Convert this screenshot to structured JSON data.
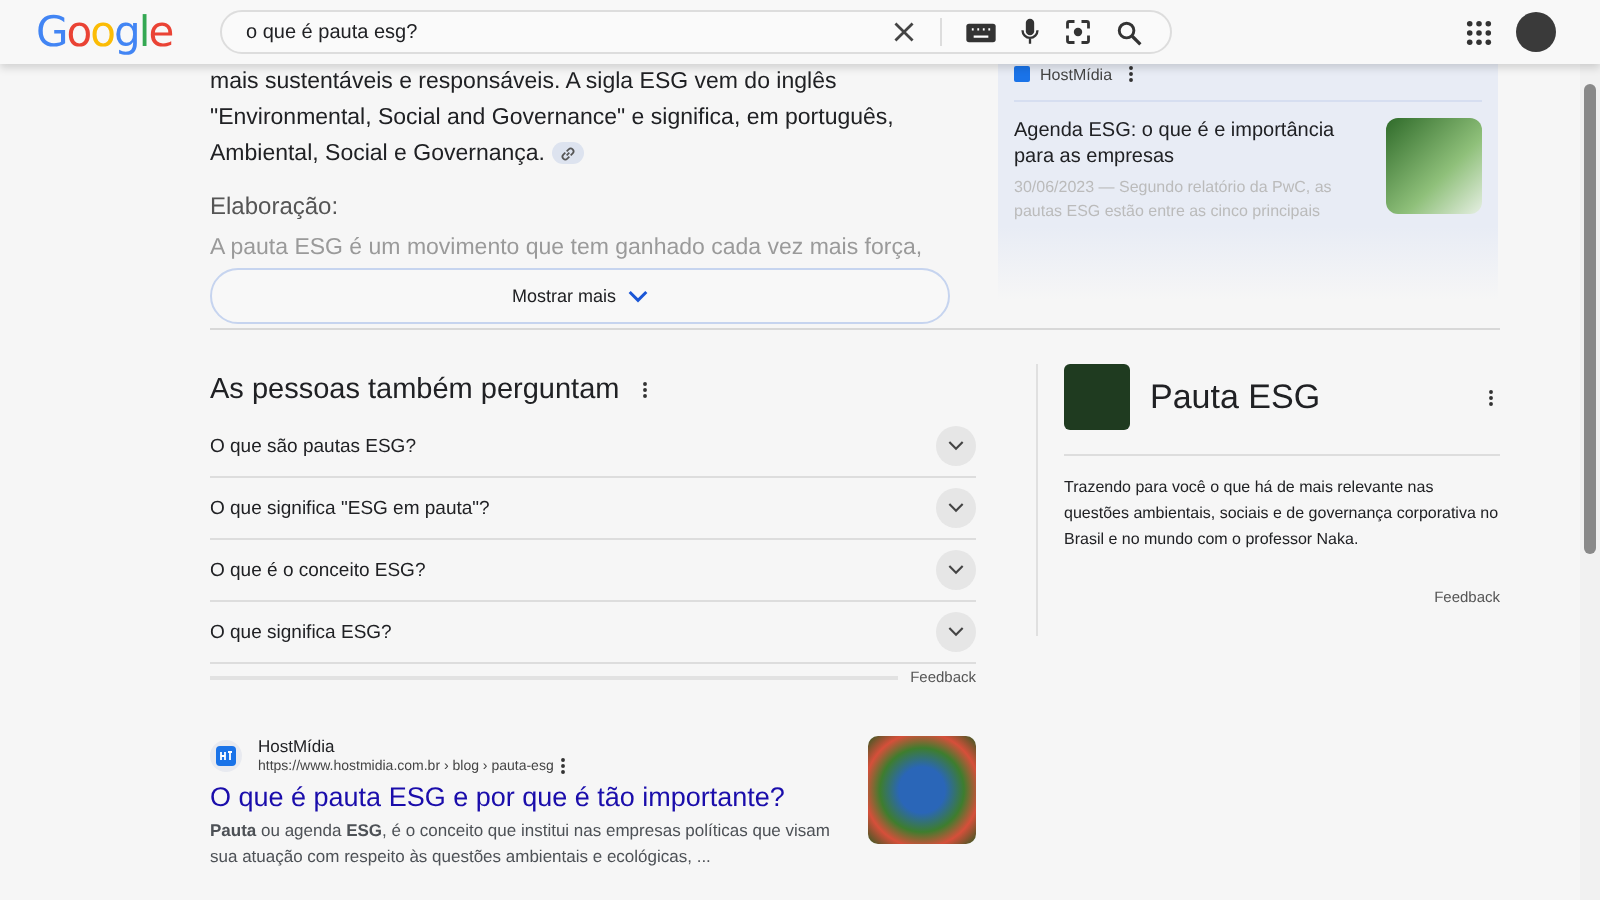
{
  "header": {
    "logo": "Google",
    "query": "o que é pauta esg?"
  },
  "answer": {
    "paragraph": "mais sustentáveis e responsáveis. A sigla ESG vem do inglês \"Environmental, Social and Governance\" e significa, em português, Ambiental, Social e Governança.",
    "subheading": "Elaboração:",
    "faded_text": "A pauta ESG é um movimento que tem ganhado cada vez mais força,",
    "more_button": "Mostrar mais"
  },
  "side_results": [
    {
      "source": "HostMídia"
    },
    {
      "title": "Agenda ESG: o que é e importância para as empresas",
      "snippet": "30/06/2023 — Segundo relatório da PwC, as pautas ESG estão entre as cinco principais"
    }
  ],
  "people_also_ask": {
    "title": "As pessoas também perguntam",
    "questions": [
      {
        "text": "O que são pautas ESG?",
        "expanded": false
      },
      {
        "text": "O que significa \"ESG em pauta\"?",
        "expanded": false
      },
      {
        "text": "O que é o conceito ESG?",
        "expanded": false
      },
      {
        "text": "O que significa ESG?",
        "expanded": false
      }
    ],
    "feedback": "Feedback"
  },
  "knowledge_panel": {
    "title": "Pauta ESG",
    "description": "Trazendo para você o que há de mais relevante nas questões ambientais, sociais e de governança corporativa no Brasil e no mundo com o professor Naka.",
    "feedback": "Feedback"
  },
  "result": {
    "site": "HostMídia",
    "url": "https://www.hostmidia.com.br › blog › pauta-esg",
    "title": "O que é pauta ESG e por que é tão importante?",
    "snippet": "**Pauta** ou agenda **ESG**, é o conceito que institui nas empresas políticas que visam sua atuação com respeito às questões ambientais e ecológicas, ..."
  }
}
